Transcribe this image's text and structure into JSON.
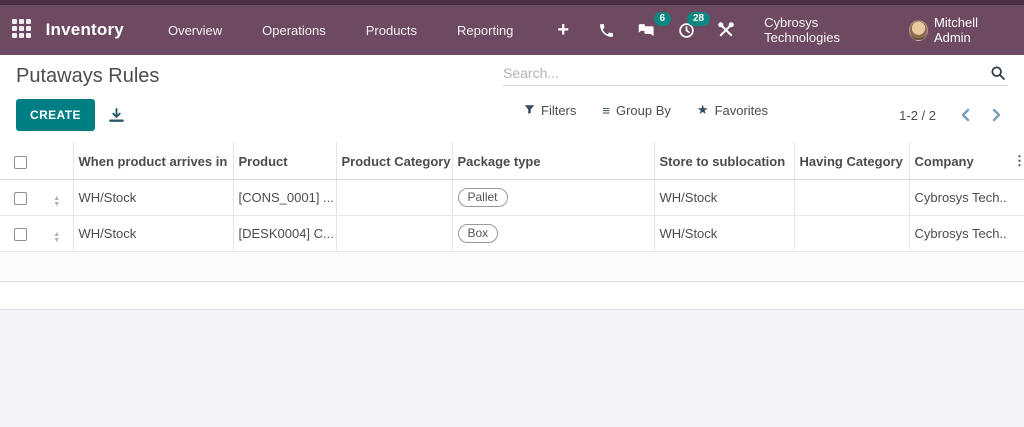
{
  "navbar": {
    "brand": "Inventory",
    "menus": [
      "Overview",
      "Operations",
      "Products",
      "Reporting"
    ],
    "systray": {
      "messages_count": "6",
      "activities_count": "28"
    },
    "company": "Cybrosys Technologies",
    "user": "Mitchell Admin"
  },
  "control_panel": {
    "title": "Putaways Rules",
    "search_placeholder": "Search...",
    "create_label": "CREATE",
    "filters_label": "Filters",
    "group_by_label": "Group By",
    "favorites_label": "Favorites",
    "pager_value": "1-2 / 2"
  },
  "table": {
    "headers": {
      "arrives_in": "When product arrives in",
      "product": "Product",
      "product_category": "Product Category",
      "package_type": "Package type",
      "sublocation": "Store to sublocation",
      "having_category": "Having Category",
      "company": "Company"
    },
    "rows": [
      {
        "arrives_in": "WH/Stock",
        "product": "[CONS_0001] ...",
        "product_category": "",
        "package_type": "Pallet",
        "sublocation": "WH/Stock",
        "having_category": "",
        "company": "Cybrosys Tech..."
      },
      {
        "arrives_in": "WH/Stock",
        "product": "[DESK0004] C...",
        "product_category": "",
        "package_type": "Box",
        "sublocation": "WH/Stock",
        "having_category": "",
        "company": "Cybrosys Tech..."
      }
    ]
  },
  "icons": {
    "plus": "+",
    "group_by": "≡",
    "favorites": "★",
    "kebab": "⋮",
    "sort_up": "▲",
    "sort_down": "▼"
  },
  "colors": {
    "navbar_bg": "#6d4a62",
    "navbar_strip": "#4a2e43",
    "accent_teal": "#017e84",
    "badge_teal": "#0d8781",
    "pager_arrow_blue": "#7c9db8",
    "bottom_bg": "#f2f4f8"
  }
}
